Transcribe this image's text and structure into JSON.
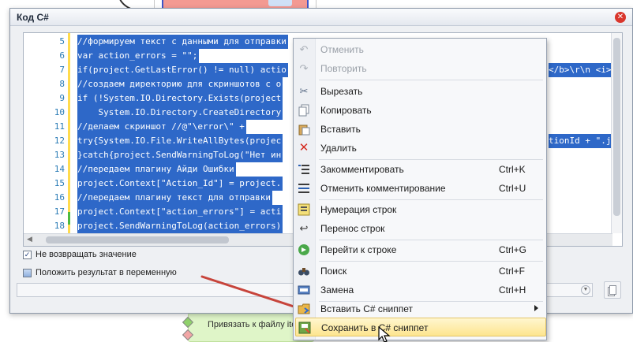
{
  "window": {
    "title": "Код C#"
  },
  "editor": {
    "lines": [
      {
        "num": "5",
        "text": "//формируем текст с данными для отправки"
      },
      {
        "num": "6",
        "text": "var action_errors = \"\";"
      },
      {
        "num": "7",
        "text": "if(project.GetLastError() != null) actio",
        "tail": "</b>\\r\\n <i>"
      },
      {
        "num": "8",
        "text": "//создаем директорию для скриншотов с о"
      },
      {
        "num": "9",
        "text": "if (!System.IO.Directory.Exists(project"
      },
      {
        "num": "10",
        "text": "    System.IO.Directory.CreateDirectory"
      },
      {
        "num": "11",
        "text": "//делаем скриншот //@\"\\error\\\" +"
      },
      {
        "num": "12",
        "text": "try{System.IO.File.WriteAllBytes(projec",
        "tail": "tionId + \".j"
      },
      {
        "num": "13",
        "text": "}catch{project.SendWarningToLog(\"Нет ин"
      },
      {
        "num": "14",
        "text": "//передаем плагину Айди Ошибки"
      },
      {
        "num": "15",
        "text": "project.Context[\"Action_Id\"] = project."
      },
      {
        "num": "16",
        "text": "//передаем плагину текст для отправки"
      },
      {
        "num": "17",
        "text": "project.Context[\"action_errors\"] = acti"
      },
      {
        "num": "18",
        "text": "project.SendWarningToLog(action_errors)"
      }
    ]
  },
  "options": {
    "no_return_label": "Не возвращать значение",
    "no_return_checked": true,
    "put_result_label": "Положить результат в переменную",
    "put_result_checked": false
  },
  "background": {
    "action_label": "Привязать к файлу items"
  },
  "context_menu": {
    "items": [
      {
        "label": "Отменить",
        "icon": "undo-icon",
        "disabled": true
      },
      {
        "label": "Повторить",
        "icon": "redo-icon",
        "disabled": true
      },
      {
        "label": "Вырезать",
        "icon": "scissors-icon"
      },
      {
        "label": "Копировать",
        "icon": "copy-icon"
      },
      {
        "label": "Вставить",
        "icon": "paste-icon"
      },
      {
        "label": "Удалить",
        "icon": "delete-icon"
      },
      {
        "label": "Закомментировать",
        "icon": "comment-icon",
        "shortcut": "Ctrl+K"
      },
      {
        "label": "Отменить комментирование",
        "icon": "uncomment-icon",
        "shortcut": "Ctrl+U"
      },
      {
        "label": "Нумерация строк",
        "icon": "line-numbers-icon"
      },
      {
        "label": "Перенос строк",
        "icon": "word-wrap-icon"
      },
      {
        "label": "Перейти к строке",
        "icon": "goto-line-icon",
        "shortcut": "Ctrl+G"
      },
      {
        "label": "Поиск",
        "icon": "binoculars-icon",
        "shortcut": "Ctrl+F"
      },
      {
        "label": "Замена",
        "icon": "replace-icon",
        "shortcut": "Ctrl+H"
      },
      {
        "label": "Вставить C# сниппет",
        "icon": "insert-snippet-icon",
        "submenu": true
      },
      {
        "label": "Сохранить в C# сниппет",
        "icon": "save-snippet-icon",
        "highlighted": true
      }
    ]
  },
  "colors": {
    "selection": "#2e68c8",
    "highlight": "#fde58f",
    "arrow": "#c7443b"
  }
}
